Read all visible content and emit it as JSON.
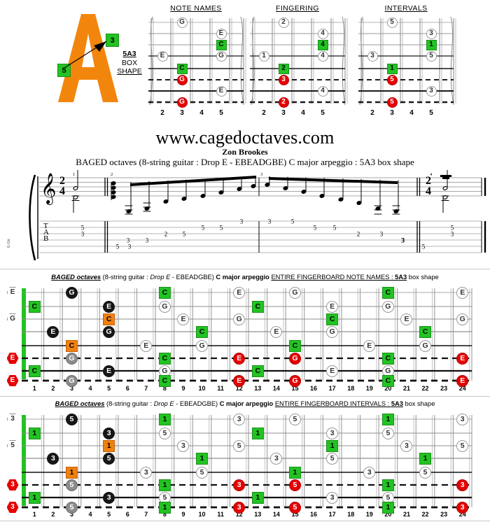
{
  "logo": {
    "letter": "A",
    "marker_high": "3",
    "marker_low": "5",
    "box_line1": "5A3",
    "box_line2": "BOX",
    "box_line3": "SHAPE"
  },
  "header": {
    "site_title": "www.cagedoctaves.com",
    "author": "Zon Brookes",
    "subtitle": "BAGED octaves (8-string guitar : Drop E - EBEADGBE) C major arpeggio : 5A3 box shape"
  },
  "colors": {
    "green": "#22c322",
    "orange": "#f08010",
    "red": "#e60000",
    "black": "#161616",
    "grey": "#8c8c8c",
    "white": "#ffffff",
    "nut_green": "#22c322"
  },
  "mini_diagrams": [
    {
      "title": "NOTE NAMES",
      "fret_labels": [
        "2",
        "3",
        "4",
        "5"
      ],
      "markers": [
        {
          "string": 1,
          "fret": 3,
          "label": "G",
          "style": "o-white"
        },
        {
          "string": 2,
          "fret": 5,
          "label": "E",
          "style": "o-white"
        },
        {
          "string": 3,
          "fret": 5,
          "label": "C",
          "style": "sq-green"
        },
        {
          "string": 4,
          "fret": 2,
          "label": "E",
          "style": "o-white"
        },
        {
          "string": 4,
          "fret": 5,
          "label": "G",
          "style": "o-white"
        },
        {
          "string": 5,
          "fret": 3,
          "label": "C",
          "style": "sq-green"
        },
        {
          "string": 6,
          "fret": 3,
          "label": "G",
          "style": "o-red"
        },
        {
          "string": 7,
          "fret": 5,
          "label": "E",
          "style": "o-white"
        },
        {
          "string": 8,
          "fret": 3,
          "label": "G",
          "style": "o-red"
        }
      ]
    },
    {
      "title": "FINGERING",
      "fret_labels": [
        "2",
        "3",
        "4",
        "5"
      ],
      "markers": [
        {
          "string": 1,
          "fret": 3,
          "label": "2",
          "style": "o-white"
        },
        {
          "string": 2,
          "fret": 5,
          "label": "4",
          "style": "o-white"
        },
        {
          "string": 3,
          "fret": 5,
          "label": "4",
          "style": "sq-green"
        },
        {
          "string": 4,
          "fret": 2,
          "label": "1",
          "style": "o-white"
        },
        {
          "string": 4,
          "fret": 5,
          "label": "4",
          "style": "o-white"
        },
        {
          "string": 5,
          "fret": 3,
          "label": "2",
          "style": "sq-green"
        },
        {
          "string": 6,
          "fret": 3,
          "label": "3",
          "style": "o-red"
        },
        {
          "string": 7,
          "fret": 5,
          "label": "4",
          "style": "o-white"
        },
        {
          "string": 8,
          "fret": 3,
          "label": "2",
          "style": "o-red"
        }
      ]
    },
    {
      "title": "INTERVALS",
      "fret_labels": [
        "2",
        "3",
        "4",
        "5"
      ],
      "markers": [
        {
          "string": 1,
          "fret": 3,
          "label": "5",
          "style": "o-white"
        },
        {
          "string": 2,
          "fret": 5,
          "label": "3",
          "style": "o-white"
        },
        {
          "string": 3,
          "fret": 5,
          "label": "1",
          "style": "sq-green"
        },
        {
          "string": 4,
          "fret": 2,
          "label": "3",
          "style": "o-white"
        },
        {
          "string": 4,
          "fret": 5,
          "label": "5",
          "style": "o-white"
        },
        {
          "string": 5,
          "fret": 3,
          "label": "1",
          "style": "sq-green"
        },
        {
          "string": 6,
          "fret": 3,
          "label": "5",
          "style": "o-red"
        },
        {
          "string": 7,
          "fret": 5,
          "label": "3",
          "style": "o-white"
        },
        {
          "string": 8,
          "fret": 3,
          "label": "5",
          "style": "o-red"
        }
      ]
    }
  ],
  "notation": {
    "tab_letters": [
      "T",
      "A",
      "B"
    ],
    "time_signature": {
      "top": "2",
      "bottom": "4"
    },
    "measure_numbers": [
      "1",
      "2",
      "3",
      "4"
    ],
    "side_label": "E-Gtr",
    "tab_bar1": [
      {
        "string": 2,
        "fret": "5"
      },
      {
        "string": 3,
        "fret": "3"
      }
    ],
    "tab_bar2": [
      {
        "string": 5,
        "fret": "5"
      },
      {
        "string": 4,
        "fret": "3"
      },
      {
        "string": 5,
        "fret": "3"
      },
      {
        "string": 4,
        "fret": "3"
      },
      {
        "string": 3,
        "fret": "2"
      },
      {
        "string": 3,
        "fret": "5"
      },
      {
        "string": 2,
        "fret": "5"
      },
      {
        "string": 2,
        "fret": "5"
      },
      {
        "string": 1,
        "fret": "3"
      }
    ],
    "tab_bar3": [
      {
        "string": 1,
        "fret": "3"
      },
      {
        "string": 1,
        "fret": "5"
      },
      {
        "string": 2,
        "fret": "5"
      },
      {
        "string": 2,
        "fret": "5"
      },
      {
        "string": 3,
        "fret": "2"
      },
      {
        "string": 3,
        "fret": "3"
      },
      {
        "string": 4,
        "fret": "3"
      },
      {
        "string": 5,
        "fret": "5"
      },
      {
        "string": 4,
        "fret": "3"
      }
    ],
    "tab_bar4": [
      {
        "string": 2,
        "fret": "5"
      },
      {
        "string": 3,
        "fret": "3"
      }
    ]
  },
  "fretboard_note_names": {
    "caption": {
      "baged": "BAGED octaves",
      "paren_open": "(8-string guitar : ",
      "tuning_italic": "Drop E",
      "tuning_rest": " - EBEADGBE)",
      "arpeggio_bold": "C",
      "arpeggio_rest": " major arpeggio",
      "scope": "ENTIRE FINGERBOARD  NOTE NAMES",
      "colon": " : ",
      "shape_bold": "5A3",
      "shape_rest": " box shape"
    },
    "fret_labels": [
      "1",
      "2",
      "3",
      "4",
      "5",
      "6",
      "7",
      "8",
      "9",
      "10",
      "11",
      "12",
      "13",
      "14",
      "15",
      "16",
      "17",
      "18",
      "19",
      "20",
      "21",
      "22",
      "23",
      "24"
    ],
    "open_notes": [
      {
        "string": 1,
        "label": "E",
        "style": "hex"
      },
      {
        "string": 3,
        "label": "G",
        "style": "hex"
      },
      {
        "string": 6,
        "label": "E",
        "style": "hexred"
      },
      {
        "string": 8,
        "label": "E",
        "style": "hexred"
      }
    ],
    "markers": [
      {
        "string": 1,
        "fret": 3,
        "label": "G",
        "style": "o-black"
      },
      {
        "string": 1,
        "fret": 8,
        "label": "C",
        "style": "sq-green"
      },
      {
        "string": 1,
        "fret": 12,
        "label": "E",
        "style": "o-white"
      },
      {
        "string": 1,
        "fret": 15,
        "label": "G",
        "style": "o-white"
      },
      {
        "string": 1,
        "fret": 20,
        "label": "C",
        "style": "sq-green"
      },
      {
        "string": 1,
        "fret": 24,
        "label": "E",
        "style": "o-white"
      },
      {
        "string": 2,
        "fret": 1,
        "label": "C",
        "style": "sq-green"
      },
      {
        "string": 2,
        "fret": 5,
        "label": "E",
        "style": "o-black"
      },
      {
        "string": 2,
        "fret": 8,
        "label": "G",
        "style": "o-white"
      },
      {
        "string": 2,
        "fret": 13,
        "label": "C",
        "style": "sq-green"
      },
      {
        "string": 2,
        "fret": 17,
        "label": "E",
        "style": "o-white"
      },
      {
        "string": 2,
        "fret": 20,
        "label": "G",
        "style": "o-white"
      },
      {
        "string": 3,
        "fret": 5,
        "label": "C",
        "style": "sq-orange"
      },
      {
        "string": 3,
        "fret": 9,
        "label": "E",
        "style": "o-white"
      },
      {
        "string": 3,
        "fret": 12,
        "label": "G",
        "style": "o-white"
      },
      {
        "string": 3,
        "fret": 17,
        "label": "C",
        "style": "sq-green"
      },
      {
        "string": 3,
        "fret": 21,
        "label": "E",
        "style": "o-white"
      },
      {
        "string": 3,
        "fret": 24,
        "label": "G",
        "style": "o-white"
      },
      {
        "string": 4,
        "fret": 2,
        "label": "E",
        "style": "o-black"
      },
      {
        "string": 4,
        "fret": 5,
        "label": "G",
        "style": "o-black"
      },
      {
        "string": 4,
        "fret": 10,
        "label": "C",
        "style": "sq-green"
      },
      {
        "string": 4,
        "fret": 14,
        "label": "E",
        "style": "o-white"
      },
      {
        "string": 4,
        "fret": 17,
        "label": "G",
        "style": "o-white"
      },
      {
        "string": 4,
        "fret": 22,
        "label": "C",
        "style": "sq-green"
      },
      {
        "string": 5,
        "fret": 3,
        "label": "C",
        "style": "sq-orange"
      },
      {
        "string": 5,
        "fret": 7,
        "label": "E",
        "style": "o-white"
      },
      {
        "string": 5,
        "fret": 10,
        "label": "G",
        "style": "o-white"
      },
      {
        "string": 5,
        "fret": 15,
        "label": "C",
        "style": "sq-green"
      },
      {
        "string": 5,
        "fret": 19,
        "label": "E",
        "style": "o-white"
      },
      {
        "string": 5,
        "fret": 22,
        "label": "G",
        "style": "o-white"
      },
      {
        "string": 6,
        "fret": 3,
        "label": "G",
        "style": "o-grey"
      },
      {
        "string": 6,
        "fret": 8,
        "label": "C",
        "style": "sq-green"
      },
      {
        "string": 6,
        "fret": 12,
        "label": "E",
        "style": "o-red"
      },
      {
        "string": 6,
        "fret": 15,
        "label": "G",
        "style": "o-red"
      },
      {
        "string": 6,
        "fret": 20,
        "label": "C",
        "style": "sq-green"
      },
      {
        "string": 6,
        "fret": 24,
        "label": "E",
        "style": "o-red"
      },
      {
        "string": 7,
        "fret": 1,
        "label": "C",
        "style": "sq-green"
      },
      {
        "string": 7,
        "fret": 5,
        "label": "E",
        "style": "o-black"
      },
      {
        "string": 7,
        "fret": 8,
        "label": "G",
        "style": "o-white"
      },
      {
        "string": 7,
        "fret": 13,
        "label": "C",
        "style": "sq-green"
      },
      {
        "string": 7,
        "fret": 17,
        "label": "E",
        "style": "o-white"
      },
      {
        "string": 7,
        "fret": 20,
        "label": "G",
        "style": "o-white"
      },
      {
        "string": 8,
        "fret": 3,
        "label": "G",
        "style": "o-grey"
      },
      {
        "string": 8,
        "fret": 8,
        "label": "C",
        "style": "sq-green"
      },
      {
        "string": 8,
        "fret": 12,
        "label": "E",
        "style": "o-red"
      },
      {
        "string": 8,
        "fret": 15,
        "label": "G",
        "style": "o-red"
      },
      {
        "string": 8,
        "fret": 20,
        "label": "C",
        "style": "sq-green"
      },
      {
        "string": 8,
        "fret": 24,
        "label": "E",
        "style": "o-red"
      }
    ]
  },
  "fretboard_intervals": {
    "caption": {
      "baged": "BAGED octaves",
      "paren_open": "(8-string guitar : ",
      "tuning_italic": "Drop E",
      "tuning_rest": " - EBEADGBE)",
      "arpeggio_bold": "C",
      "arpeggio_rest": " major arpeggio",
      "scope": "ENTIRE FINGERBOARD  INTERVALS",
      "colon": " : ",
      "shape_bold": "5A3",
      "shape_rest": " box shape"
    },
    "fret_labels": [
      "1",
      "2",
      "3",
      "4",
      "5",
      "6",
      "7",
      "8",
      "9",
      "10",
      "11",
      "12",
      "13",
      "14",
      "15",
      "16",
      "17",
      "18",
      "19",
      "20",
      "21",
      "22",
      "23",
      "24"
    ],
    "open_notes": [
      {
        "string": 1,
        "label": "3",
        "style": "hex"
      },
      {
        "string": 3,
        "label": "5",
        "style": "hex"
      },
      {
        "string": 6,
        "label": "3",
        "style": "hexred"
      },
      {
        "string": 8,
        "label": "3",
        "style": "hexred"
      }
    ],
    "markers": [
      {
        "string": 1,
        "fret": 3,
        "label": "5",
        "style": "o-black"
      },
      {
        "string": 1,
        "fret": 8,
        "label": "1",
        "style": "sq-green"
      },
      {
        "string": 1,
        "fret": 12,
        "label": "3",
        "style": "o-white"
      },
      {
        "string": 1,
        "fret": 15,
        "label": "5",
        "style": "o-white"
      },
      {
        "string": 1,
        "fret": 20,
        "label": "1",
        "style": "sq-green"
      },
      {
        "string": 1,
        "fret": 24,
        "label": "3",
        "style": "o-white"
      },
      {
        "string": 2,
        "fret": 1,
        "label": "1",
        "style": "sq-green"
      },
      {
        "string": 2,
        "fret": 5,
        "label": "3",
        "style": "o-black"
      },
      {
        "string": 2,
        "fret": 8,
        "label": "5",
        "style": "o-white"
      },
      {
        "string": 2,
        "fret": 13,
        "label": "1",
        "style": "sq-green"
      },
      {
        "string": 2,
        "fret": 17,
        "label": "3",
        "style": "o-white"
      },
      {
        "string": 2,
        "fret": 20,
        "label": "5",
        "style": "o-white"
      },
      {
        "string": 3,
        "fret": 5,
        "label": "1",
        "style": "sq-orange"
      },
      {
        "string": 3,
        "fret": 9,
        "label": "3",
        "style": "o-white"
      },
      {
        "string": 3,
        "fret": 12,
        "label": "5",
        "style": "o-white"
      },
      {
        "string": 3,
        "fret": 17,
        "label": "1",
        "style": "sq-green"
      },
      {
        "string": 3,
        "fret": 21,
        "label": "3",
        "style": "o-white"
      },
      {
        "string": 3,
        "fret": 24,
        "label": "5",
        "style": "o-white"
      },
      {
        "string": 4,
        "fret": 2,
        "label": "3",
        "style": "o-black"
      },
      {
        "string": 4,
        "fret": 5,
        "label": "5",
        "style": "o-black"
      },
      {
        "string": 4,
        "fret": 10,
        "label": "1",
        "style": "sq-green"
      },
      {
        "string": 4,
        "fret": 14,
        "label": "3",
        "style": "o-white"
      },
      {
        "string": 4,
        "fret": 17,
        "label": "5",
        "style": "o-white"
      },
      {
        "string": 4,
        "fret": 22,
        "label": "1",
        "style": "sq-green"
      },
      {
        "string": 5,
        "fret": 3,
        "label": "1",
        "style": "sq-orange"
      },
      {
        "string": 5,
        "fret": 7,
        "label": "3",
        "style": "o-white"
      },
      {
        "string": 5,
        "fret": 10,
        "label": "5",
        "style": "o-white"
      },
      {
        "string": 5,
        "fret": 15,
        "label": "1",
        "style": "sq-green"
      },
      {
        "string": 5,
        "fret": 19,
        "label": "3",
        "style": "o-white"
      },
      {
        "string": 5,
        "fret": 22,
        "label": "5",
        "style": "o-white"
      },
      {
        "string": 6,
        "fret": 3,
        "label": "5",
        "style": "o-grey"
      },
      {
        "string": 6,
        "fret": 8,
        "label": "1",
        "style": "sq-green"
      },
      {
        "string": 6,
        "fret": 12,
        "label": "3",
        "style": "o-red"
      },
      {
        "string": 6,
        "fret": 15,
        "label": "5",
        "style": "o-red"
      },
      {
        "string": 6,
        "fret": 20,
        "label": "1",
        "style": "sq-green"
      },
      {
        "string": 6,
        "fret": 24,
        "label": "3",
        "style": "o-red"
      },
      {
        "string": 7,
        "fret": 1,
        "label": "1",
        "style": "sq-green"
      },
      {
        "string": 7,
        "fret": 5,
        "label": "3",
        "style": "o-black"
      },
      {
        "string": 7,
        "fret": 8,
        "label": "5",
        "style": "o-white"
      },
      {
        "string": 7,
        "fret": 13,
        "label": "1",
        "style": "sq-green"
      },
      {
        "string": 7,
        "fret": 17,
        "label": "3",
        "style": "o-white"
      },
      {
        "string": 7,
        "fret": 20,
        "label": "5",
        "style": "o-white"
      },
      {
        "string": 8,
        "fret": 3,
        "label": "5",
        "style": "o-grey"
      },
      {
        "string": 8,
        "fret": 8,
        "label": "1",
        "style": "sq-green"
      },
      {
        "string": 8,
        "fret": 12,
        "label": "3",
        "style": "o-red"
      },
      {
        "string": 8,
        "fret": 15,
        "label": "5",
        "style": "o-red"
      },
      {
        "string": 8,
        "fret": 20,
        "label": "1",
        "style": "sq-green"
      },
      {
        "string": 8,
        "fret": 24,
        "label": "3",
        "style": "o-red"
      }
    ]
  }
}
